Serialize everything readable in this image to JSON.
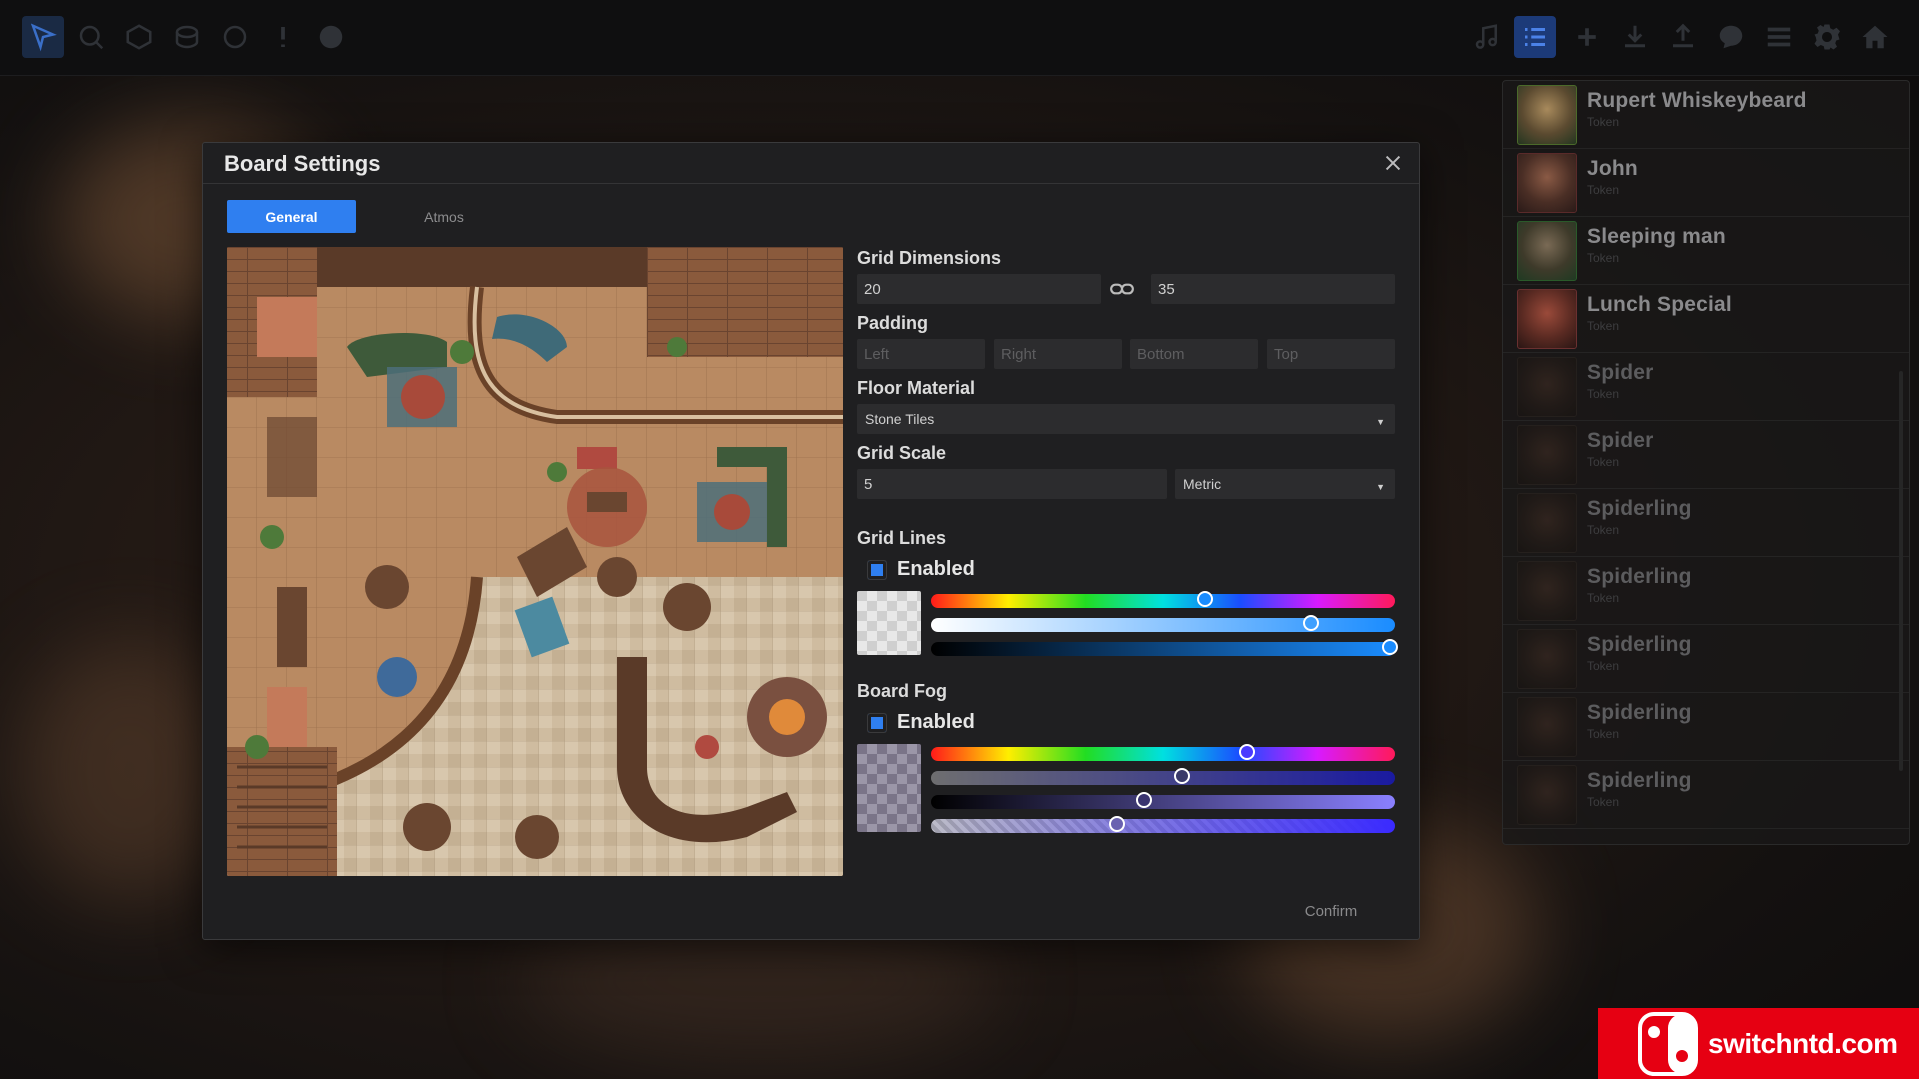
{
  "toolbar": {
    "left_tools": [
      "pointer-icon",
      "measure-icon",
      "dice-icon",
      "stack-icon",
      "shape-icon",
      "alert-icon",
      "grid-icon"
    ],
    "right_tools": [
      "music-icon",
      "list-icon",
      "add-icon",
      "download-icon",
      "upload-icon",
      "chat-icon",
      "menu-icon",
      "gear-icon",
      "home-icon"
    ]
  },
  "sidebar": {
    "tokens": [
      {
        "name": "Rupert Whiskeybeard",
        "sub": "Token"
      },
      {
        "name": "John",
        "sub": "Token"
      },
      {
        "name": "Sleeping man",
        "sub": "Token"
      },
      {
        "name": "Lunch Special",
        "sub": "Token"
      },
      {
        "name": "Spider",
        "sub": "Token"
      },
      {
        "name": "Spider",
        "sub": "Token"
      },
      {
        "name": "Spiderling",
        "sub": "Token"
      },
      {
        "name": "Spiderling",
        "sub": "Token"
      },
      {
        "name": "Spiderling",
        "sub": "Token"
      },
      {
        "name": "Spiderling",
        "sub": "Token"
      },
      {
        "name": "Spiderling",
        "sub": "Token"
      }
    ]
  },
  "dialog": {
    "title": "Board Settings",
    "tabs": [
      "General",
      "Atmos"
    ],
    "grid_dimensions": {
      "label": "Grid Dimensions",
      "width": "20",
      "height": "35"
    },
    "padding": {
      "label": "Padding",
      "left": "Left",
      "right": "Right",
      "bottom": "Bottom",
      "top": "Top"
    },
    "floor_material": {
      "label": "Floor Material",
      "value": "Stone Tiles"
    },
    "grid_scale": {
      "label": "Grid Scale",
      "value": "5",
      "unit": "Metric"
    },
    "grid_lines": {
      "label": "Grid Lines",
      "enabled_label": "Enabled",
      "enabled": true,
      "sliders": {
        "hue": 0.59,
        "saturation": 0.82,
        "brightness": 0.99
      }
    },
    "board_fog": {
      "label": "Board Fog",
      "enabled_label": "Enabled",
      "enabled": true,
      "sliders": {
        "hue": 0.68,
        "saturation": 0.54,
        "brightness": 0.46,
        "alpha": 0.4
      }
    },
    "confirm_label": "Confirm"
  },
  "colors": {
    "accent": "#2f7ff0",
    "dialog_bg": "#1f1f21",
    "input_bg": "#2c2c2e"
  },
  "watermark": {
    "text": "switchntd.com"
  }
}
